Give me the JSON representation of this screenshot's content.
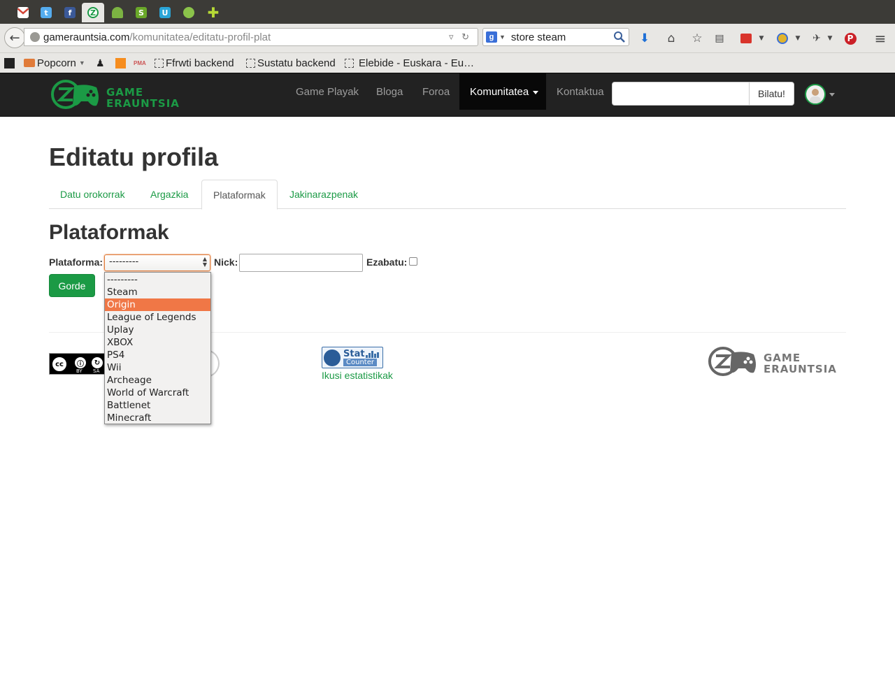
{
  "browser": {
    "url_host": "gamerauntsia.com",
    "url_path": "/komunitatea/editatu-profil-plat",
    "search_value": "store steam",
    "search_engine_letter": "g",
    "tabs": [
      "gmail-icon",
      "twitter-icon",
      "facebook-icon",
      "gamerauntsia-icon",
      "android-icon",
      "slack-icon",
      "u-icon",
      "green-icon",
      "new-tab-icon"
    ],
    "bookmarks": {
      "popcorn": "Popcorn",
      "ffrwti": "Ffrwti backend",
      "sustatu": "Sustatu backend",
      "elebide": "Elebide - Euskara - Eu…",
      "pma": "PMA"
    }
  },
  "site": {
    "logo_line1": "GAME",
    "logo_line2": "ERAUNTSIA",
    "nav": {
      "game_playak": "Game Playak",
      "bloga": "Bloga",
      "foroa": "Foroa",
      "komunitatea": "Komunitatea",
      "kontaktua": "Kontaktua"
    },
    "search_button": "Bilatu!",
    "search_value": ""
  },
  "page": {
    "title": "Editatu profila",
    "tabs": {
      "datu_orokorrak": "Datu orokorrak",
      "argazkia": "Argazkia",
      "plataformak": "Plataformak",
      "jakinarazpenak": "Jakinarazpenak"
    },
    "active_tab": "Plataformak",
    "section_title": "Plataformak",
    "form": {
      "plataforma_label": "Plataforma:",
      "plataforma_value": "---------",
      "nick_label": "Nick:",
      "nick_value": "",
      "ezabatu_label": "Ezabatu:",
      "ezabatu_checked": false,
      "save_button": "Gorde"
    },
    "dropdown_options": [
      "---------",
      "Steam",
      "Origin",
      "League of Legends",
      "Uplay",
      "XBOX",
      "PS4",
      "Wii",
      "Archeage",
      "World of Warcraft",
      "Battlenet",
      "Minecraft"
    ],
    "dropdown_highlighted": "Origin"
  },
  "footer": {
    "cc_by": "BY",
    "cc_sa": "SA",
    "cc_text": "cc",
    "stat_word": "Stat",
    "counter_word": "Counter",
    "stats_link": "Ikusi estatistikak",
    "logo_line1": "GAME",
    "logo_line2": "ERAUNTSIA"
  },
  "colors": {
    "brand_green": "#1b9a45",
    "highlight_orange": "#f07746",
    "navbar_bg": "#222222"
  }
}
